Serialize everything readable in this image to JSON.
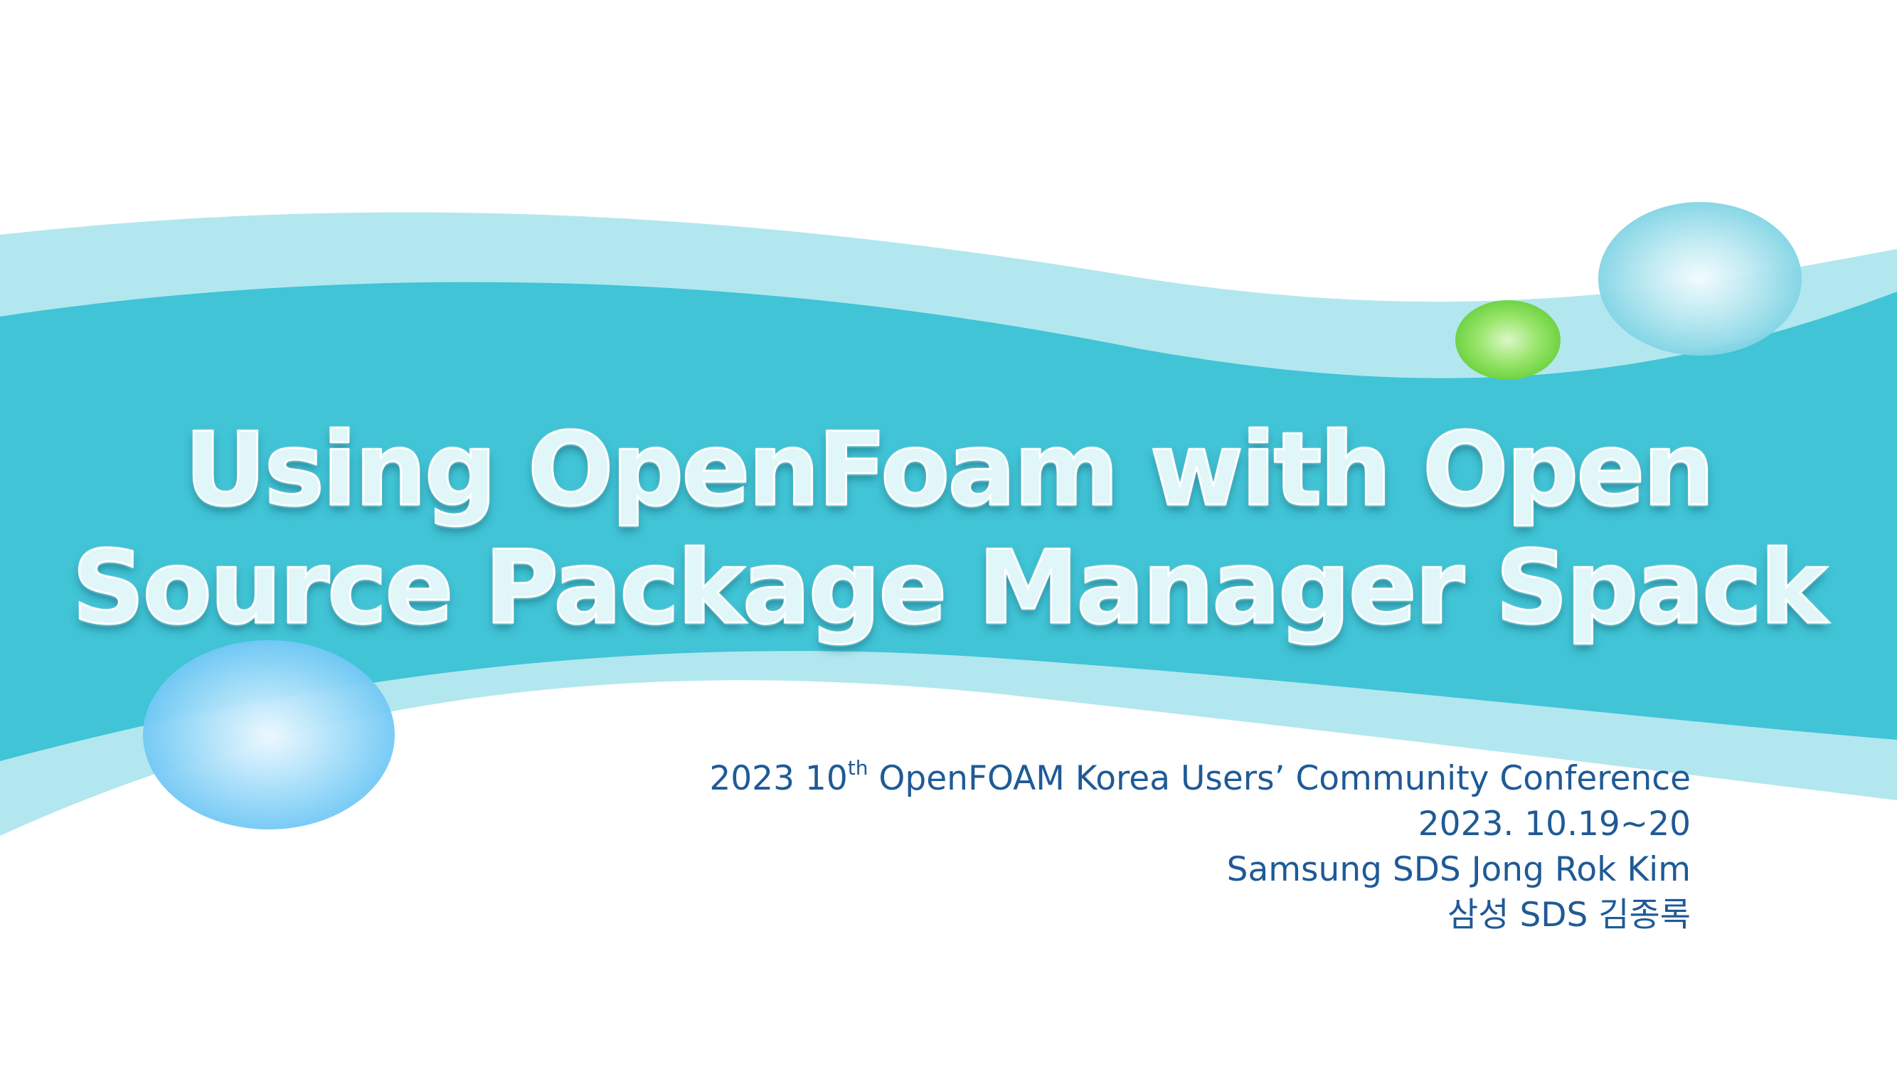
{
  "slide": {
    "title_line1": "Using OpenFoam with Open",
    "title_line2": "Source Package Manager Spack",
    "info": {
      "conference_prefix": "2023 10",
      "conference_ordinal_suffix": "th",
      "conference_rest": " OpenFOAM Korea Users’ Community Conference",
      "date": "2023. 10.19~20",
      "presenter_en": "Samsung SDS Jong Rok Kim",
      "presenter_ko": "삼성 SDS 김종록"
    }
  },
  "colors": {
    "wave_dark": "#40c4d6",
    "wave_light": "#b2e7ef",
    "text_blue": "#1f5a96",
    "bubble_green": "#77d94a",
    "bubble_cyan": "#7dd4e4",
    "bubble_sky": "#74c8f5"
  }
}
